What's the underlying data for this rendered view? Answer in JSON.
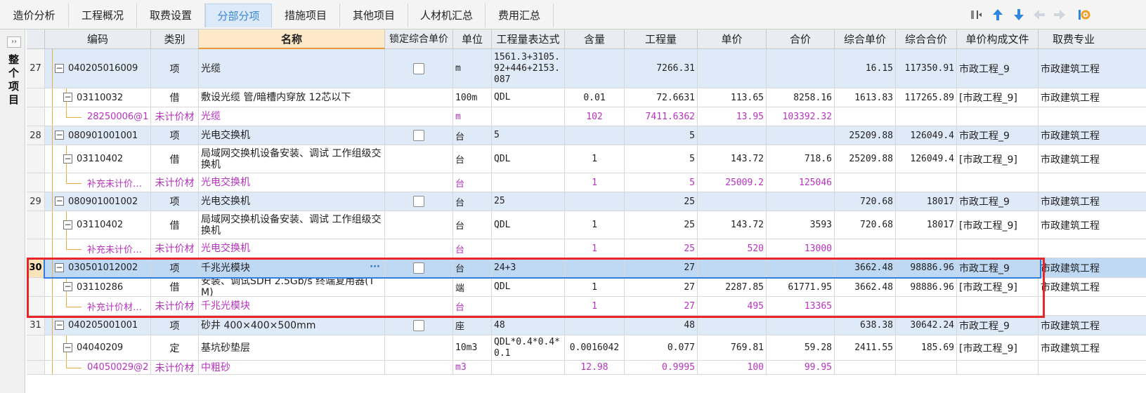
{
  "tabs": [
    {
      "label": "造价分析"
    },
    {
      "label": "工程概况"
    },
    {
      "label": "取费设置"
    },
    {
      "label": "分部分项"
    },
    {
      "label": "措施项目"
    },
    {
      "label": "其他项目"
    },
    {
      "label": "人材机汇总"
    },
    {
      "label": "费用汇总"
    }
  ],
  "active_tab": "分部分项",
  "toolbar_icons": [
    "insert-column-icon",
    "arrow-up-icon",
    "arrow-down-icon",
    "arrow-left-icon",
    "arrow-right-icon",
    "settings-icon"
  ],
  "left_panel": {
    "expand_label": "››",
    "title": "整个项目"
  },
  "columns": [
    "编码",
    "类别",
    "名称",
    "锁定综合单价",
    "单位",
    "工程量表达式",
    "含量",
    "工程量",
    "单价",
    "合价",
    "综合单价",
    "综合合价",
    "单价构成文件",
    "取费专业"
  ],
  "rows": [
    {
      "num": "27",
      "type": "item",
      "code": "040205016009",
      "cat": "项",
      "name": "光缆",
      "lock": true,
      "unit": "m",
      "expr": "1561.3+3105.92+446+2153.087",
      "content": "",
      "qty": "7266.31",
      "price": "",
      "total": "",
      "cprice": "16.15",
      "ctotal": "117350.91",
      "file": "市政工程_9",
      "spec": "市政建筑工程"
    },
    {
      "num": "",
      "type": "sub",
      "code": "03110032",
      "cat": "借",
      "name": "敷设光缆 管/暗槽内穿放 12芯以下",
      "lock": false,
      "unit": "100m",
      "expr": "QDL",
      "content": "0.01",
      "qty": "72.6631",
      "price": "113.65",
      "total": "8258.16",
      "cprice": "1613.83",
      "ctotal": "117265.89",
      "file": "[市政工程_9]",
      "spec": "市政建筑工程"
    },
    {
      "num": "",
      "type": "mat",
      "code": "28250006@1",
      "cat": "未计价材",
      "name": "光缆",
      "lock": false,
      "unit": "m",
      "expr": "",
      "content": "102",
      "qty": "7411.6362",
      "price": "13.95",
      "total": "103392.32",
      "cprice": "",
      "ctotal": "",
      "file": "",
      "spec": ""
    },
    {
      "num": "28",
      "type": "item",
      "code": "080901001001",
      "cat": "项",
      "name": "光电交换机",
      "lock": true,
      "unit": "台",
      "expr": "5",
      "content": "",
      "qty": "5",
      "price": "",
      "total": "",
      "cprice": "25209.88",
      "ctotal": "126049.4",
      "file": "市政工程_9",
      "spec": "市政建筑工程"
    },
    {
      "num": "",
      "type": "sub",
      "code": "03110402",
      "cat": "借",
      "name": "局域网交换机设备安装、调试 工作组级交换机",
      "lock": false,
      "unit": "台",
      "expr": "QDL",
      "content": "1",
      "qty": "5",
      "price": "143.72",
      "total": "718.6",
      "cprice": "25209.88",
      "ctotal": "126049.4",
      "file": "[市政工程_9]",
      "spec": "市政建筑工程"
    },
    {
      "num": "",
      "type": "mat",
      "code": "补充未计价…",
      "cat": "未计价材",
      "name": "光电交换机",
      "lock": false,
      "unit": "台",
      "expr": "",
      "content": "1",
      "qty": "5",
      "price": "25009.2",
      "total": "125046",
      "cprice": "",
      "ctotal": "",
      "file": "",
      "spec": ""
    },
    {
      "num": "29",
      "type": "item",
      "code": "080901001002",
      "cat": "项",
      "name": "光电交换机",
      "lock": true,
      "unit": "台",
      "expr": "25",
      "content": "",
      "qty": "25",
      "price": "",
      "total": "",
      "cprice": "720.68",
      "ctotal": "18017",
      "file": "市政工程_9",
      "spec": "市政建筑工程"
    },
    {
      "num": "",
      "type": "sub",
      "code": "03110402",
      "cat": "借",
      "name": "局域网交换机设备安装、调试 工作组级交换机",
      "lock": false,
      "unit": "台",
      "expr": "QDL",
      "content": "1",
      "qty": "25",
      "price": "143.72",
      "total": "3593",
      "cprice": "720.68",
      "ctotal": "18017",
      "file": "[市政工程_9]",
      "spec": "市政建筑工程"
    },
    {
      "num": "",
      "type": "mat",
      "code": "补充未计价…",
      "cat": "未计价材",
      "name": "光电交换机",
      "lock": false,
      "unit": "台",
      "expr": "",
      "content": "1",
      "qty": "25",
      "price": "520",
      "total": "13000",
      "cprice": "",
      "ctotal": "",
      "file": "",
      "spec": ""
    },
    {
      "num": "30",
      "type": "sel",
      "code": "030501012002",
      "cat": "项",
      "name": "千兆光模块",
      "lock": true,
      "unit": "台",
      "expr": "24+3",
      "content": "",
      "qty": "27",
      "price": "",
      "total": "",
      "cprice": "3662.48",
      "ctotal": "98886.96",
      "file": "市政工程_9",
      "spec": "市政建筑工程"
    },
    {
      "num": "",
      "type": "sub",
      "code": "03110286",
      "cat": "借",
      "name": "安装、调试SDH 2.5Gb/s 终端复用器(TM)",
      "lock": false,
      "unit": "端",
      "expr": "QDL",
      "content": "1",
      "qty": "27",
      "price": "2287.85",
      "total": "61771.95",
      "cprice": "3662.48",
      "ctotal": "98886.96",
      "file": "[市政工程_9]",
      "spec": "市政建筑工程"
    },
    {
      "num": "",
      "type": "mat",
      "code": "补充计价材…",
      "cat": "未计价材",
      "name": "千兆光模块",
      "lock": false,
      "unit": "台",
      "expr": "",
      "content": "1",
      "qty": "27",
      "price": "495",
      "total": "13365",
      "cprice": "",
      "ctotal": "",
      "file": "",
      "spec": ""
    },
    {
      "num": "31",
      "type": "item",
      "code": "040205001001",
      "cat": "项",
      "name": "砂井 400×400×500mm",
      "lock": true,
      "unit": "座",
      "expr": "48",
      "content": "",
      "qty": "48",
      "price": "",
      "total": "",
      "cprice": "638.38",
      "ctotal": "30642.24",
      "file": "市政工程_9",
      "spec": "市政建筑工程"
    },
    {
      "num": "",
      "type": "sub",
      "code": "04040209",
      "cat": "定",
      "name": "基坑砂垫层",
      "lock": false,
      "unit": "10m3",
      "expr": "QDL*0.4*0.4*0.1",
      "content": "0.0016042",
      "qty": "0.077",
      "price": "769.81",
      "total": "59.28",
      "cprice": "2411.55",
      "ctotal": "185.69",
      "file": "[市政工程_9]",
      "spec": "市政建筑工程"
    },
    {
      "num": "",
      "type": "mat",
      "code": "04050029@2",
      "cat": "未计价材",
      "name": "中粗砂",
      "lock": false,
      "unit": "m3",
      "expr": "",
      "content": "12.98",
      "qty": "0.9995",
      "price": "100",
      "total": "99.95",
      "cprice": "",
      "ctotal": "",
      "file": "",
      "spec": ""
    }
  ],
  "colors": {
    "accent": "#3a86d6",
    "highlight_border": "#e8262a",
    "material_text": "#b832c0",
    "item_row_bg": "#dfeaf8"
  }
}
